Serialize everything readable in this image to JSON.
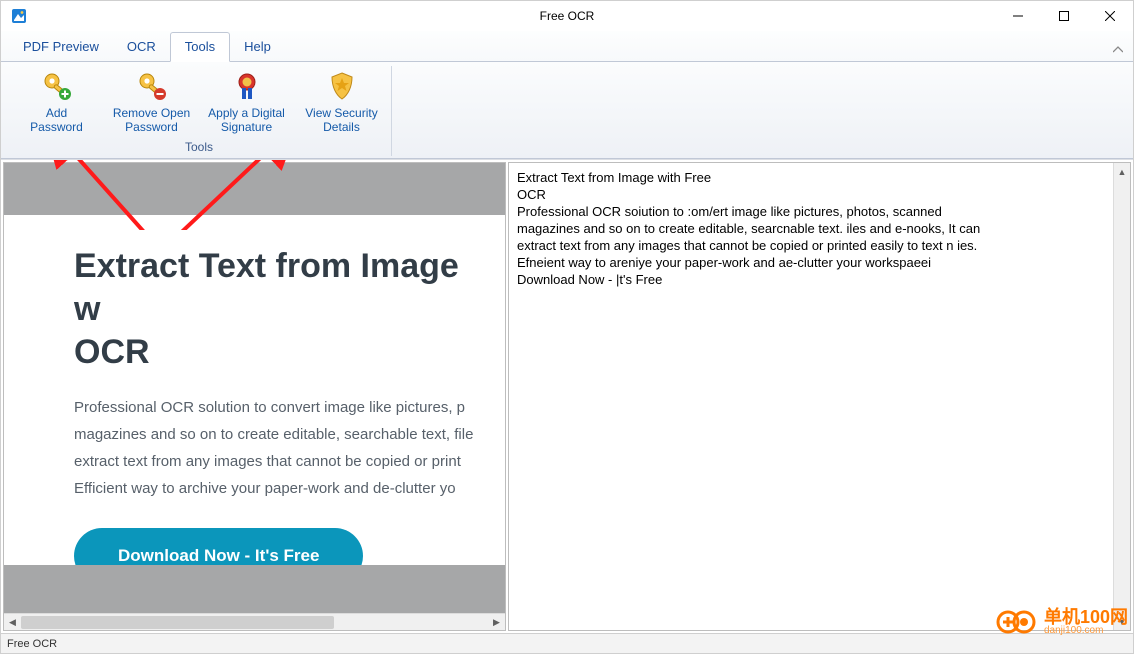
{
  "window": {
    "title": "Free OCR"
  },
  "menu": {
    "items": [
      "PDF Preview",
      "OCR",
      "Tools",
      "Help"
    ],
    "active_index": 2
  },
  "ribbon": {
    "group_label": "Tools",
    "buttons": [
      {
        "label_line1": "Add",
        "label_line2": "Password"
      },
      {
        "label_line1": "Remove Open",
        "label_line2": "Password"
      },
      {
        "label_line1": "Apply a Digital",
        "label_line2": "Signature"
      },
      {
        "label_line1": "View Security",
        "label_line2": "Details"
      }
    ]
  },
  "preview": {
    "heading_line1": "Extract Text from Image w",
    "heading_line2": "OCR",
    "paragraph": "Professional OCR solution to convert image like pictures, p magazines and so on to create editable, searchable text, file extract text from any images that cannot be copied or print Efficient way to archive your paper-work and de-clutter yo",
    "button_label": "Download Now - It's Free"
  },
  "ocr_output": {
    "lines": [
      "Extract Text from Image with Free",
      "OCR",
      "Professional OCR soiution to :om/ert image like pictures, photos, scanned",
      "magazines and so on to create editable, searcnable text. iles and e-nooks, It can",
      "extract text from any images that cannot be copied or printed easily to text n ies.",
      "Efneient way to areniye your paper-work and ae-clutter your workspaeei",
      "Download Now - |t's Free"
    ]
  },
  "statusbar": {
    "text": "Free OCR"
  },
  "watermark": {
    "brand": "单机100网",
    "url": "danji100.com"
  }
}
